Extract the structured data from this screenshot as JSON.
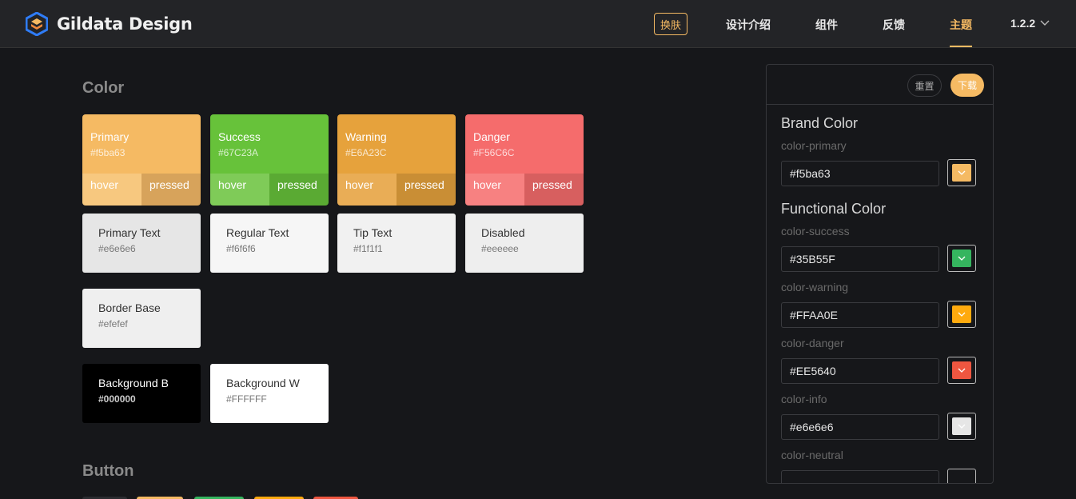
{
  "header": {
    "brand": "Gildata Design",
    "skin_button": "换肤",
    "nav": [
      "设计介绍",
      "组件",
      "反馈",
      "主题"
    ],
    "active_nav": "主题",
    "version": "1.2.2"
  },
  "sections": {
    "color": "Color",
    "button": "Button"
  },
  "color_cards": [
    {
      "name": "Primary",
      "hex": "#f5ba63",
      "color": "#f5ba63",
      "hover_label": "hover",
      "hover_color": "#f7c87f",
      "pressed_label": "pressed",
      "pressed_color": "#d7a35b"
    },
    {
      "name": "Success",
      "hex": "#67C23A",
      "color": "#67c23a",
      "hover_label": "hover",
      "hover_color": "#7fcb58",
      "pressed_label": "pressed",
      "pressed_color": "#5aaa33"
    },
    {
      "name": "Warning",
      "hex": "#E6A23C",
      "color": "#e6a23c",
      "hover_label": "hover",
      "hover_color": "#e9ad56",
      "pressed_label": "pressed",
      "pressed_color": "#c98e35"
    },
    {
      "name": "Danger",
      "hex": "#F56C6C",
      "color": "#f56c6c",
      "hover_label": "hover",
      "hover_color": "#f78181",
      "pressed_label": "pressed",
      "pressed_color": "#d75f5f"
    }
  ],
  "text_cards": [
    {
      "name": "Primary Text",
      "hex": "#e6e6e6",
      "bg": "#e6e6e6"
    },
    {
      "name": "Regular Text",
      "hex": "#f6f6f6",
      "bg": "#f6f6f6"
    },
    {
      "name": "Tip Text",
      "hex": "#f1f1f1",
      "bg": "#f1f1f1"
    },
    {
      "name": "Disabled",
      "hex": "#eeeeee",
      "bg": "#eeeeee"
    },
    {
      "name": "Border Base",
      "hex": "#efefef",
      "bg": "#efefef"
    }
  ],
  "bg_cards": [
    {
      "name": "Background B",
      "hex": "#000000",
      "bg": "#000000"
    },
    {
      "name": "Background W",
      "hex": "#FFFFFF",
      "bg": "#ffffff"
    }
  ],
  "panel": {
    "reset": "重置",
    "download": "下载",
    "brand_title": "Brand Color",
    "functional_title": "Functional Color",
    "fields": [
      {
        "label": "color-primary",
        "value": "#f5ba63",
        "swatch": "#f5ba63"
      },
      {
        "label": "color-success",
        "value": "#35B55F",
        "swatch": "#35b55f"
      },
      {
        "label": "color-warning",
        "value": "#FFAA0E",
        "swatch": "#ffaa0e"
      },
      {
        "label": "color-danger",
        "value": "#EE5640",
        "swatch": "#ee5640"
      },
      {
        "label": "color-info",
        "value": "#e6e6e6",
        "swatch": "#e6e6e6"
      },
      {
        "label": "color-neutral",
        "value": "",
        "swatch": "#16171a"
      }
    ]
  },
  "button_stub_colors": [
    "#2b2c30",
    "#f5ba63",
    "#35b55f",
    "#ffaa0e",
    "#ee5640"
  ]
}
